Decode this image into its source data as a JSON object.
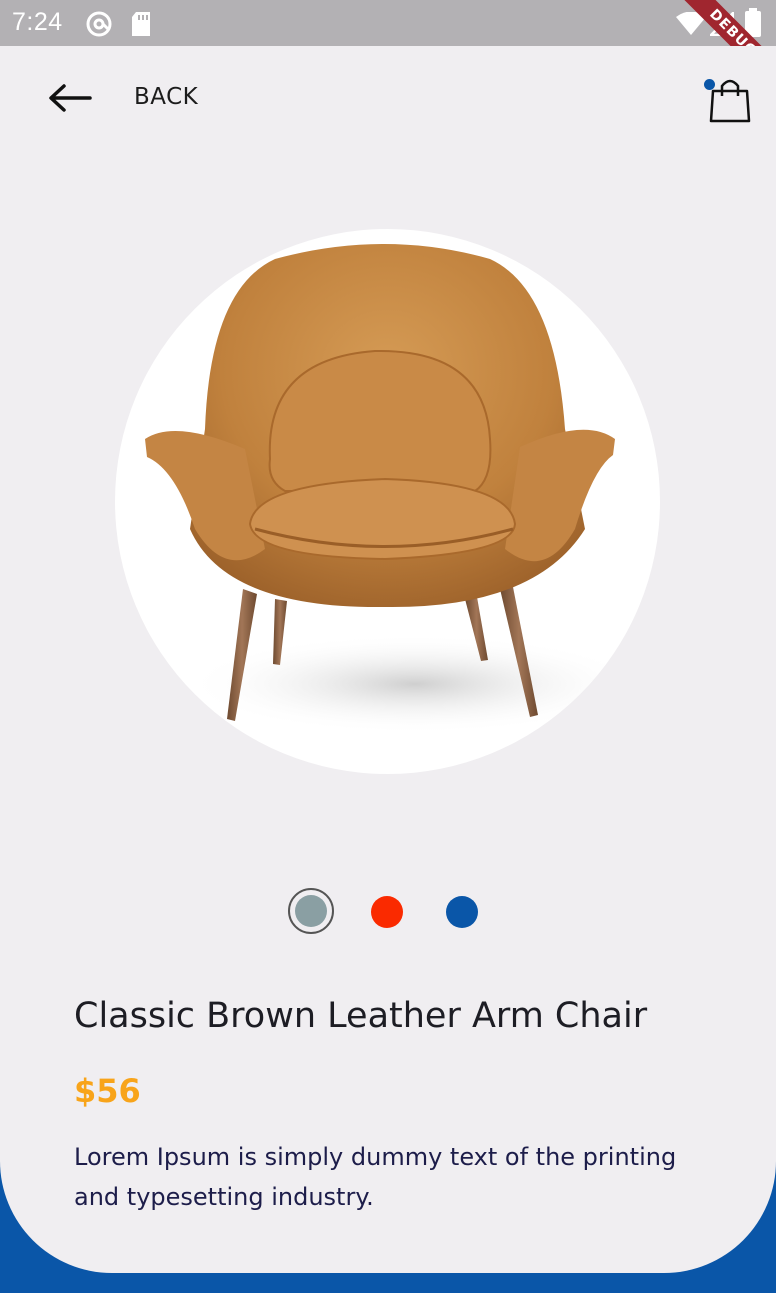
{
  "status_bar": {
    "time": "7:24",
    "debug_label": "DEBUG"
  },
  "header": {
    "back_label": "BACK",
    "back_icon": "arrow-left-icon",
    "cart_icon": "shopping-bag-icon",
    "cart_badge_color": "#0a56a8"
  },
  "product": {
    "image": "armchair",
    "title": "Classic Brown Leather Arm Chair",
    "price": "$56",
    "description": "Lorem Ipsum is simply dummy text of the printing and typesetting industry.",
    "colors": [
      {
        "name": "grey",
        "hex": "#8a9fa3",
        "selected": true
      },
      {
        "name": "red",
        "hex": "#fa2a00",
        "selected": false
      },
      {
        "name": "blue",
        "hex": "#0a56a8",
        "selected": false
      }
    ]
  },
  "theme": {
    "accent": "#0a56a8",
    "price_color": "#f8a41a",
    "background": "#f0eef1"
  }
}
